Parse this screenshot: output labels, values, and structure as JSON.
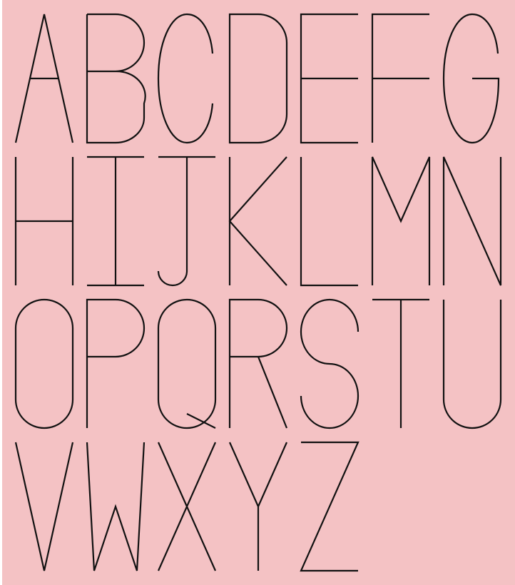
{
  "artwork": {
    "background_color": "#f4c2c4",
    "stroke_color": "#111111",
    "rows": [
      [
        "A",
        "B",
        "C",
        "D",
        "E",
        "F",
        "G"
      ],
      [
        "H",
        "I",
        "J",
        "K",
        "L",
        "M",
        "N"
      ],
      [
        "O",
        "P",
        "Q",
        "R",
        "S",
        "T",
        "U"
      ],
      [
        "V",
        "W",
        "X",
        "Y",
        "Z"
      ]
    ]
  }
}
